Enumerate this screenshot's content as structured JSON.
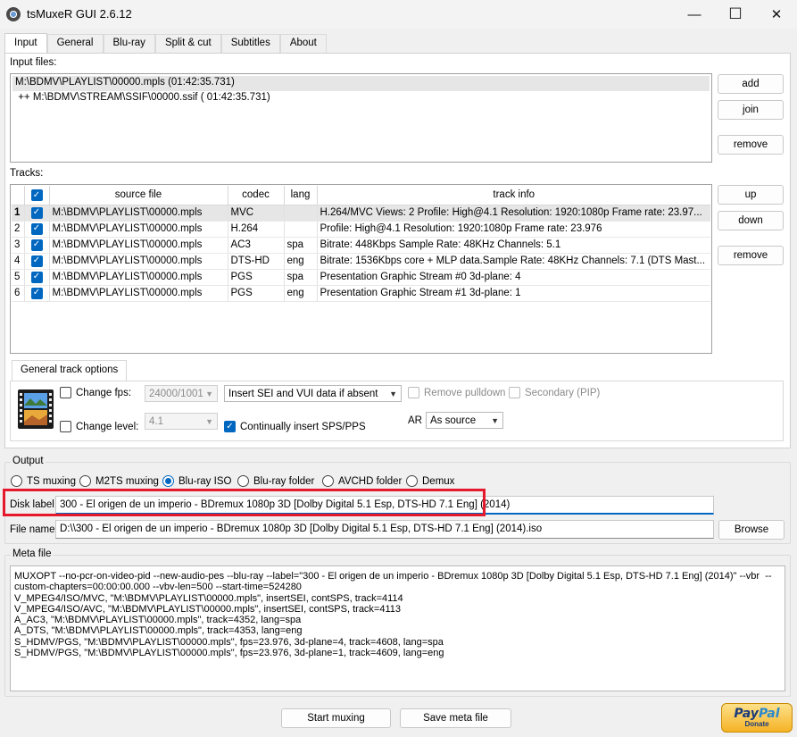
{
  "window": {
    "title": "tsMuxeR GUI 2.6.12",
    "minimize": "—",
    "maximize": "☐",
    "close": "✕"
  },
  "tabs": [
    "Input",
    "General",
    "Blu-ray",
    "Split & cut",
    "Subtitles",
    "About"
  ],
  "input_files": {
    "label": "Input files:",
    "items": [
      "M:\\BDMV\\PLAYLIST\\00000.mpls (01:42:35.731)",
      " ++ M:\\BDMV\\STREAM\\SSIF\\00000.ssif ( 01:42:35.731)"
    ],
    "buttons": {
      "add": "add",
      "join": "join",
      "remove": "remove"
    }
  },
  "tracks": {
    "label": "Tracks:",
    "columns": [
      "source file",
      "codec",
      "lang",
      "track info"
    ],
    "rows": [
      {
        "num": "1",
        "file": "M:\\BDMV\\PLAYLIST\\00000.mpls",
        "codec": "MVC",
        "lang": "",
        "info": "H.264/MVC Views: 2 Profile: High@4.1  Resolution: 1920:1080p  Frame rate: 23.97..."
      },
      {
        "num": "2",
        "file": "M:\\BDMV\\PLAYLIST\\00000.mpls",
        "codec": "H.264",
        "lang": "",
        "info": "Profile: High@4.1  Resolution: 1920:1080p  Frame rate: 23.976"
      },
      {
        "num": "3",
        "file": "M:\\BDMV\\PLAYLIST\\00000.mpls",
        "codec": "AC3",
        "lang": "spa",
        "info": "Bitrate: 448Kbps Sample Rate: 48KHz Channels: 5.1"
      },
      {
        "num": "4",
        "file": "M:\\BDMV\\PLAYLIST\\00000.mpls",
        "codec": "DTS-HD",
        "lang": "eng",
        "info": "Bitrate: 1536Kbps  core + MLP data.Sample Rate: 48KHz  Channels: 7.1 (DTS Mast..."
      },
      {
        "num": "5",
        "file": "M:\\BDMV\\PLAYLIST\\00000.mpls",
        "codec": "PGS",
        "lang": "spa",
        "info": "Presentation Graphic Stream #0  3d-plane: 4"
      },
      {
        "num": "6",
        "file": "M:\\BDMV\\PLAYLIST\\00000.mpls",
        "codec": "PGS",
        "lang": "eng",
        "info": "Presentation Graphic Stream #1  3d-plane: 1"
      }
    ],
    "buttons": {
      "up": "up",
      "down": "down",
      "remove": "remove"
    }
  },
  "general_options": {
    "tab": "General track options",
    "change_fps": "Change fps:",
    "fps_value": "24000/1001",
    "sei_value": "Insert SEI and VUI data if absent",
    "remove_pulldown": "Remove pulldown",
    "secondary": "Secondary (PIP)",
    "change_level": "Change level:",
    "level_value": "4.1",
    "continually_insert": "Continually insert SPS/PPS",
    "ar_label": "AR",
    "ar_value": "As source"
  },
  "output": {
    "label": "Output",
    "modes": [
      "TS muxing",
      "M2TS muxing",
      "Blu-ray ISO",
      "Blu-ray folder",
      "AVCHD folder",
      "Demux"
    ],
    "selected_mode": "Blu-ray ISO",
    "disk_label_label": "Disk label",
    "disk_label_value": "300 - El origen de un imperio - BDremux 1080p 3D [Dolby Digital 5.1 Esp, DTS-HD 7.1 Eng] (2014)",
    "file_name_label": "File name",
    "file_name_value": "D:\\\\300 - El origen de un imperio - BDremux 1080p 3D [Dolby Digital 5.1 Esp, DTS-HD 7.1 Eng] (2014).iso",
    "browse": "Browse"
  },
  "meta_file": {
    "label": "Meta file",
    "content": "MUXOPT --no-pcr-on-video-pid --new-audio-pes --blu-ray --label=\"300 - El origen de un imperio - BDremux 1080p 3D [Dolby Digital 5.1 Esp, DTS-HD 7.1 Eng] (2014)\" --vbr  --custom-chapters=00:00:00.000 --vbv-len=500 --start-time=524280\nV_MPEG4/ISO/MVC, \"M:\\BDMV\\PLAYLIST\\00000.mpls\", insertSEI, contSPS, track=4114\nV_MPEG4/ISO/AVC, \"M:\\BDMV\\PLAYLIST\\00000.mpls\", insertSEI, contSPS, track=4113\nA_AC3, \"M:\\BDMV\\PLAYLIST\\00000.mpls\", track=4352, lang=spa\nA_DTS, \"M:\\BDMV\\PLAYLIST\\00000.mpls\", track=4353, lang=eng\nS_HDMV/PGS, \"M:\\BDMV\\PLAYLIST\\00000.mpls\", fps=23.976, 3d-plane=4, track=4608, lang=spa\nS_HDMV/PGS, \"M:\\BDMV\\PLAYLIST\\00000.mpls\", fps=23.976, 3d-plane=1, track=4609, lang=eng"
  },
  "bottom": {
    "start": "Start muxing",
    "save_meta": "Save meta file",
    "paypal_a": "Pay",
    "paypal_b": "Pal",
    "donate": "Donate"
  },
  "colors": {
    "accent": "#0067c0",
    "highlight_box": "#e5192b"
  }
}
